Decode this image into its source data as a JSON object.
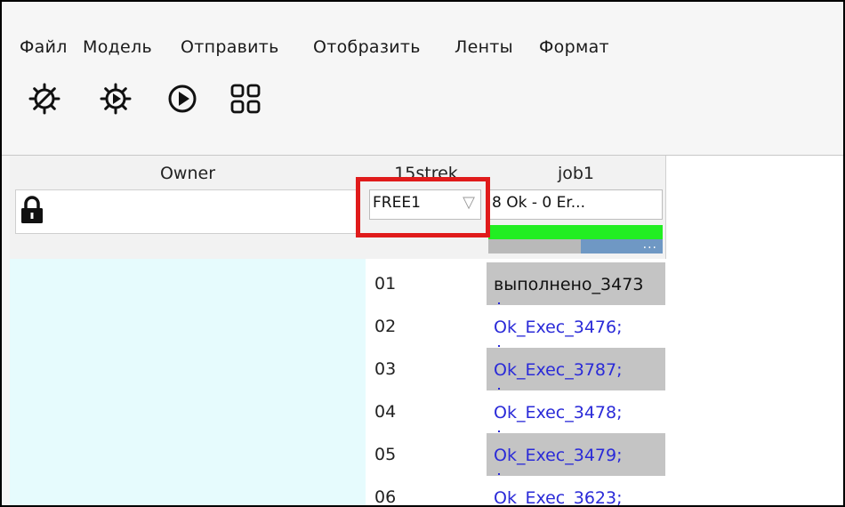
{
  "menu": [
    "Файл",
    "Модель",
    "Отправить",
    "Отобразить",
    "Ленты",
    "Формат"
  ],
  "toolbar": [
    {
      "name": "gear-stop-icon"
    },
    {
      "name": "gear-play-icon"
    },
    {
      "name": "play-circle-icon"
    },
    {
      "name": "grid-view-icon"
    }
  ],
  "columns": {
    "owner": {
      "title": "Owner",
      "lock_icon": "lock-icon",
      "value": ""
    },
    "col2": {
      "title": "15strek",
      "filter_value": "FREE1",
      "filter_arrow": "▽"
    },
    "col3": {
      "title": "job1",
      "status": "8 Ok - 0 Er...",
      "progress_green": 1.0,
      "progress_gray": 0.53,
      "progress_dots": "..."
    }
  },
  "rows": [
    {
      "num": "01",
      "value": "выполнено_3473",
      "shade": "gray",
      "color": "#111111"
    },
    {
      "num": "02",
      "value": "Ok_Exec_3476;",
      "shade": "white",
      "color": "#2a2ad8"
    },
    {
      "num": "03",
      "value": "Ok_Exec_3787;",
      "shade": "gray",
      "color": "#2a2ad8"
    },
    {
      "num": "04",
      "value": "Ok_Exec_3478;",
      "shade": "white",
      "color": "#2a2ad8"
    },
    {
      "num": "05",
      "value": "Ok_Exec_3479;",
      "shade": "gray",
      "color": "#2a2ad8"
    },
    {
      "num": "06",
      "value": "Ok_Exec_3623;",
      "shade": "white",
      "color": "#2a2ad8"
    }
  ],
  "colors": {
    "highlight": "#e01b1b",
    "progress_green": "#22ee22",
    "progress_blue": "#6f98c4",
    "row_gray": "#c4c4c4",
    "left_body": "#e6fbfd"
  }
}
